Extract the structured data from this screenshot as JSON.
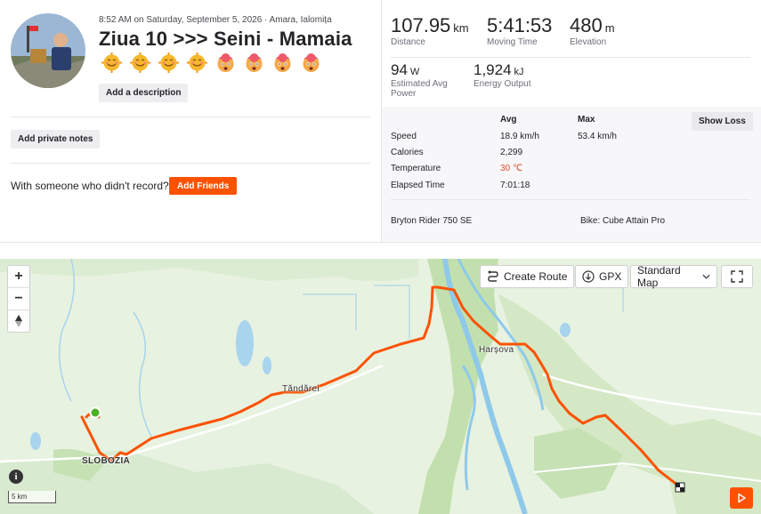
{
  "activity": {
    "meta": "8:52 AM on Saturday, September 5, 2026 · Amara, Ialomița",
    "title": "Ziua 10 >>> Seini - Mamaia",
    "add_description": "Add a description",
    "add_private_notes": "Add private notes",
    "with_someone": "With someone who didn't record?",
    "add_friends": "Add Friends",
    "kudos_emojis": [
      "smiling-face",
      "smiling-face",
      "smiling-face",
      "smiling-face",
      "exploding-head",
      "exploding-head",
      "exploding-head",
      "exploding-head"
    ]
  },
  "stats": {
    "distance": {
      "value": "107.95",
      "unit": "km",
      "label": "Distance"
    },
    "moving_time": {
      "value": "5:41:53",
      "label": "Moving Time"
    },
    "elevation": {
      "value": "480",
      "unit": "m",
      "label": "Elevation"
    },
    "power": {
      "value": "94",
      "unit": "W",
      "label": "Estimated Avg Power"
    },
    "energy": {
      "value": "1,924",
      "unit": "kJ",
      "label": "Energy Output"
    }
  },
  "details": {
    "avg_header": "Avg",
    "max_header": "Max",
    "show_loss": "Show Loss",
    "rows": [
      {
        "label": "Speed",
        "avg": "18.9 km/h",
        "max": "53.4 km/h"
      },
      {
        "label": "Calories",
        "avg": "2,299",
        "max": ""
      },
      {
        "label": "Temperature",
        "avg": "30 ℃",
        "max": ""
      },
      {
        "label": "Elapsed Time",
        "avg": "7:01:18",
        "max": ""
      }
    ],
    "device": "Bryton Rider 750 SE",
    "bike": "Bike: Cube Attain Pro"
  },
  "map": {
    "create_route": "Create Route",
    "gpx": "GPX",
    "map_type": "Standard Map",
    "scale": "5 km",
    "towns": [
      "Țăndărei",
      "Harșova",
      "SLOBOZIA"
    ],
    "colors": {
      "route": "#fc5200",
      "start": "#4caf28",
      "water": "#8fc9ea",
      "land": "#e6f1de",
      "forest": "#c6e2b4"
    }
  }
}
